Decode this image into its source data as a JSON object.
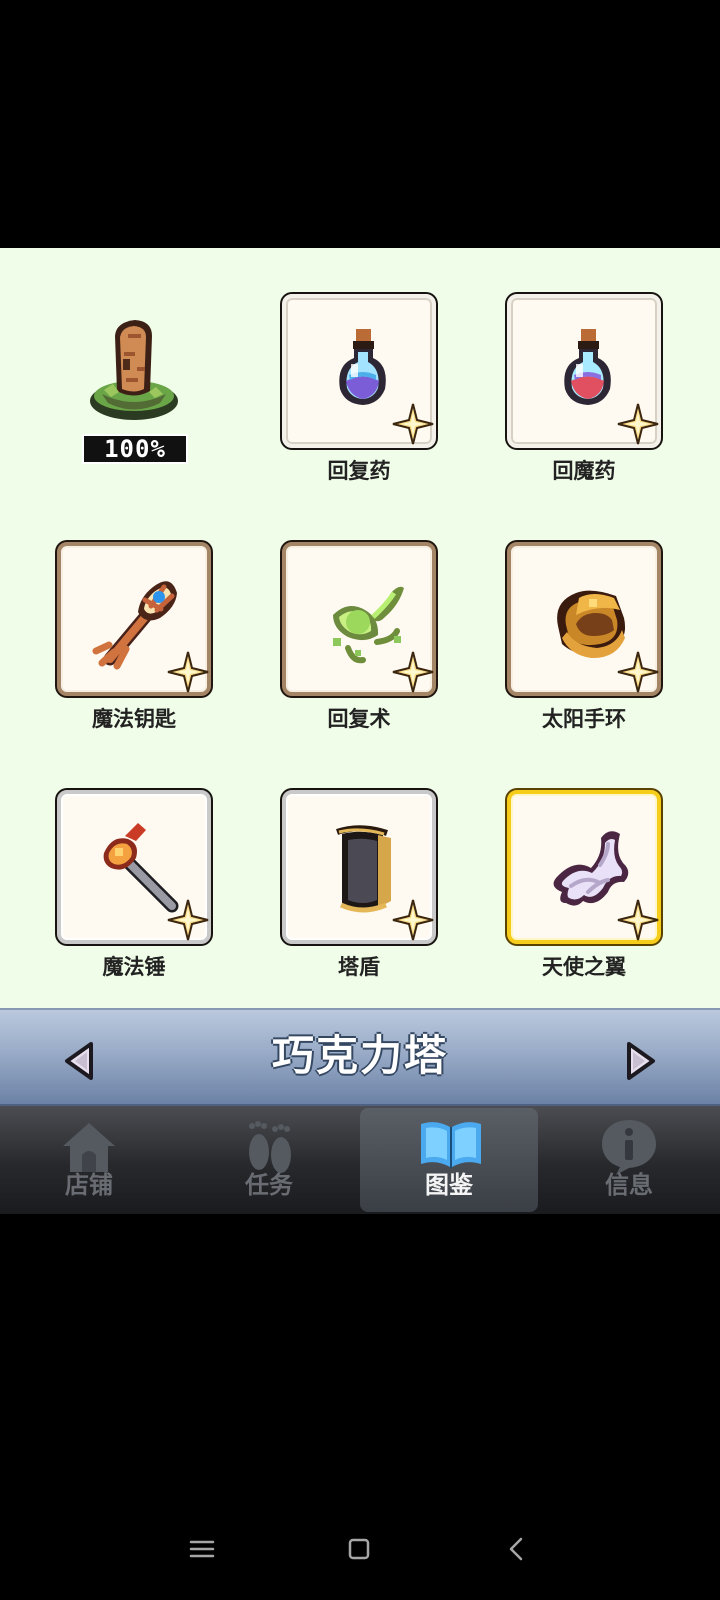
{
  "collection": {
    "completion": "100%",
    "items": [
      {
        "name": "回复药",
        "frame": "white",
        "icon": "blue-potion-icon"
      },
      {
        "name": "回魔药",
        "frame": "white",
        "icon": "red-potion-icon"
      },
      {
        "name": "魔法钥匙",
        "frame": "bronze",
        "icon": "magic-key-icon"
      },
      {
        "name": "回复术",
        "frame": "bronze",
        "icon": "healing-spell-icon"
      },
      {
        "name": "太阳手环",
        "frame": "bronze",
        "icon": "sun-bracelet-icon"
      },
      {
        "name": "魔法锤",
        "frame": "silver",
        "icon": "magic-hammer-icon"
      },
      {
        "name": "塔盾",
        "frame": "silver",
        "icon": "tower-shield-icon"
      },
      {
        "name": "天使之翼",
        "frame": "gold",
        "icon": "angel-wing-icon"
      }
    ]
  },
  "region": {
    "title": "巧克力塔"
  },
  "tabs": [
    {
      "label": "店铺",
      "icon": "house-icon",
      "active": false
    },
    {
      "label": "任务",
      "icon": "footprints-icon",
      "active": false
    },
    {
      "label": "图鉴",
      "icon": "open-book-icon",
      "active": true
    },
    {
      "label": "信息",
      "icon": "info-bubble-icon",
      "active": false
    }
  ],
  "colors": {
    "collection_background": "#f0fde8",
    "region_bar": "#99abc7",
    "active_tab": "#5a5f66",
    "gold_frame": "#f5cd1a"
  }
}
